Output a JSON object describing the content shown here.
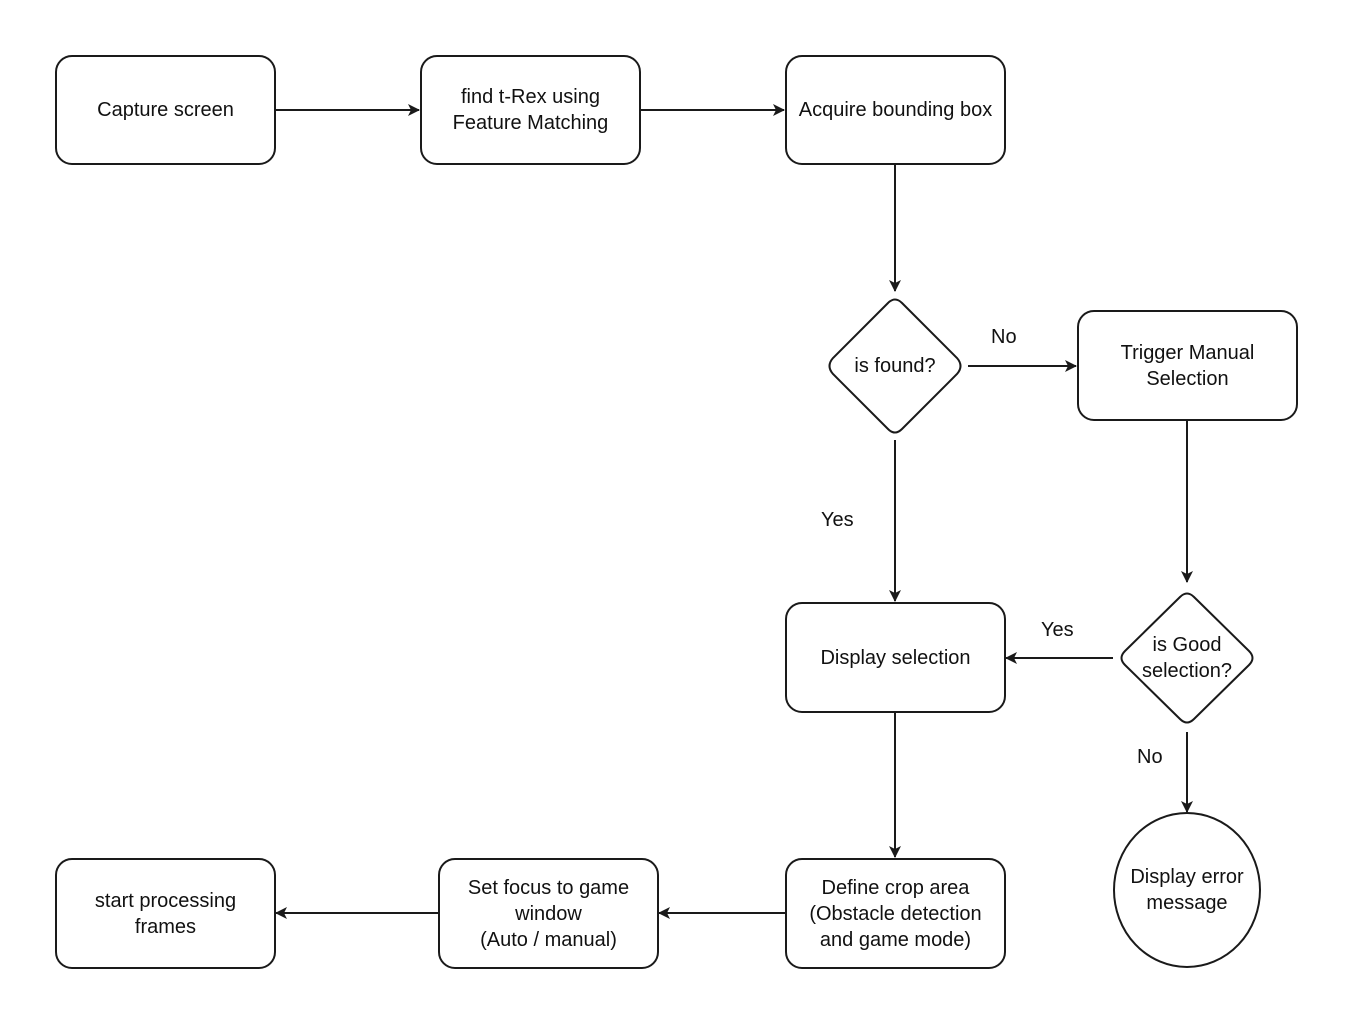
{
  "diagram": {
    "type": "flowchart",
    "nodes": {
      "capture": {
        "label": "Capture screen",
        "shape": "rounded-rect"
      },
      "find": {
        "label": "find t-Rex using\nFeature Matching",
        "shape": "rounded-rect"
      },
      "acquire": {
        "label": "Acquire bounding box",
        "shape": "rounded-rect"
      },
      "is_found": {
        "label": "is found?",
        "shape": "diamond"
      },
      "trigger": {
        "label": "Trigger Manual\nSelection",
        "shape": "rounded-rect"
      },
      "is_good": {
        "label": "is Good\nselection?",
        "shape": "diamond"
      },
      "display_sel": {
        "label": "Display selection",
        "shape": "rounded-rect"
      },
      "display_err": {
        "label": "Display error\nmessage",
        "shape": "circle"
      },
      "define_crop": {
        "label": "Define crop area\n(Obstacle detection\nand game mode)",
        "shape": "rounded-rect"
      },
      "set_focus": {
        "label": "Set focus to game\nwindow\n(Auto / manual)",
        "shape": "rounded-rect"
      },
      "start": {
        "label": "start processing\nframes",
        "shape": "rounded-rect"
      }
    },
    "edges": [
      {
        "from": "capture",
        "to": "find",
        "label": ""
      },
      {
        "from": "find",
        "to": "acquire",
        "label": ""
      },
      {
        "from": "acquire",
        "to": "is_found",
        "label": ""
      },
      {
        "from": "is_found",
        "to": "trigger",
        "label": "No"
      },
      {
        "from": "is_found",
        "to": "display_sel",
        "label": "Yes"
      },
      {
        "from": "trigger",
        "to": "is_good",
        "label": ""
      },
      {
        "from": "is_good",
        "to": "display_sel",
        "label": "Yes"
      },
      {
        "from": "is_good",
        "to": "display_err",
        "label": "No"
      },
      {
        "from": "display_sel",
        "to": "define_crop",
        "label": ""
      },
      {
        "from": "define_crop",
        "to": "set_focus",
        "label": ""
      },
      {
        "from": "set_focus",
        "to": "start",
        "label": ""
      }
    ],
    "edge_labels": {
      "found_no": "No",
      "found_yes": "Yes",
      "good_yes": "Yes",
      "good_no": "No"
    }
  }
}
